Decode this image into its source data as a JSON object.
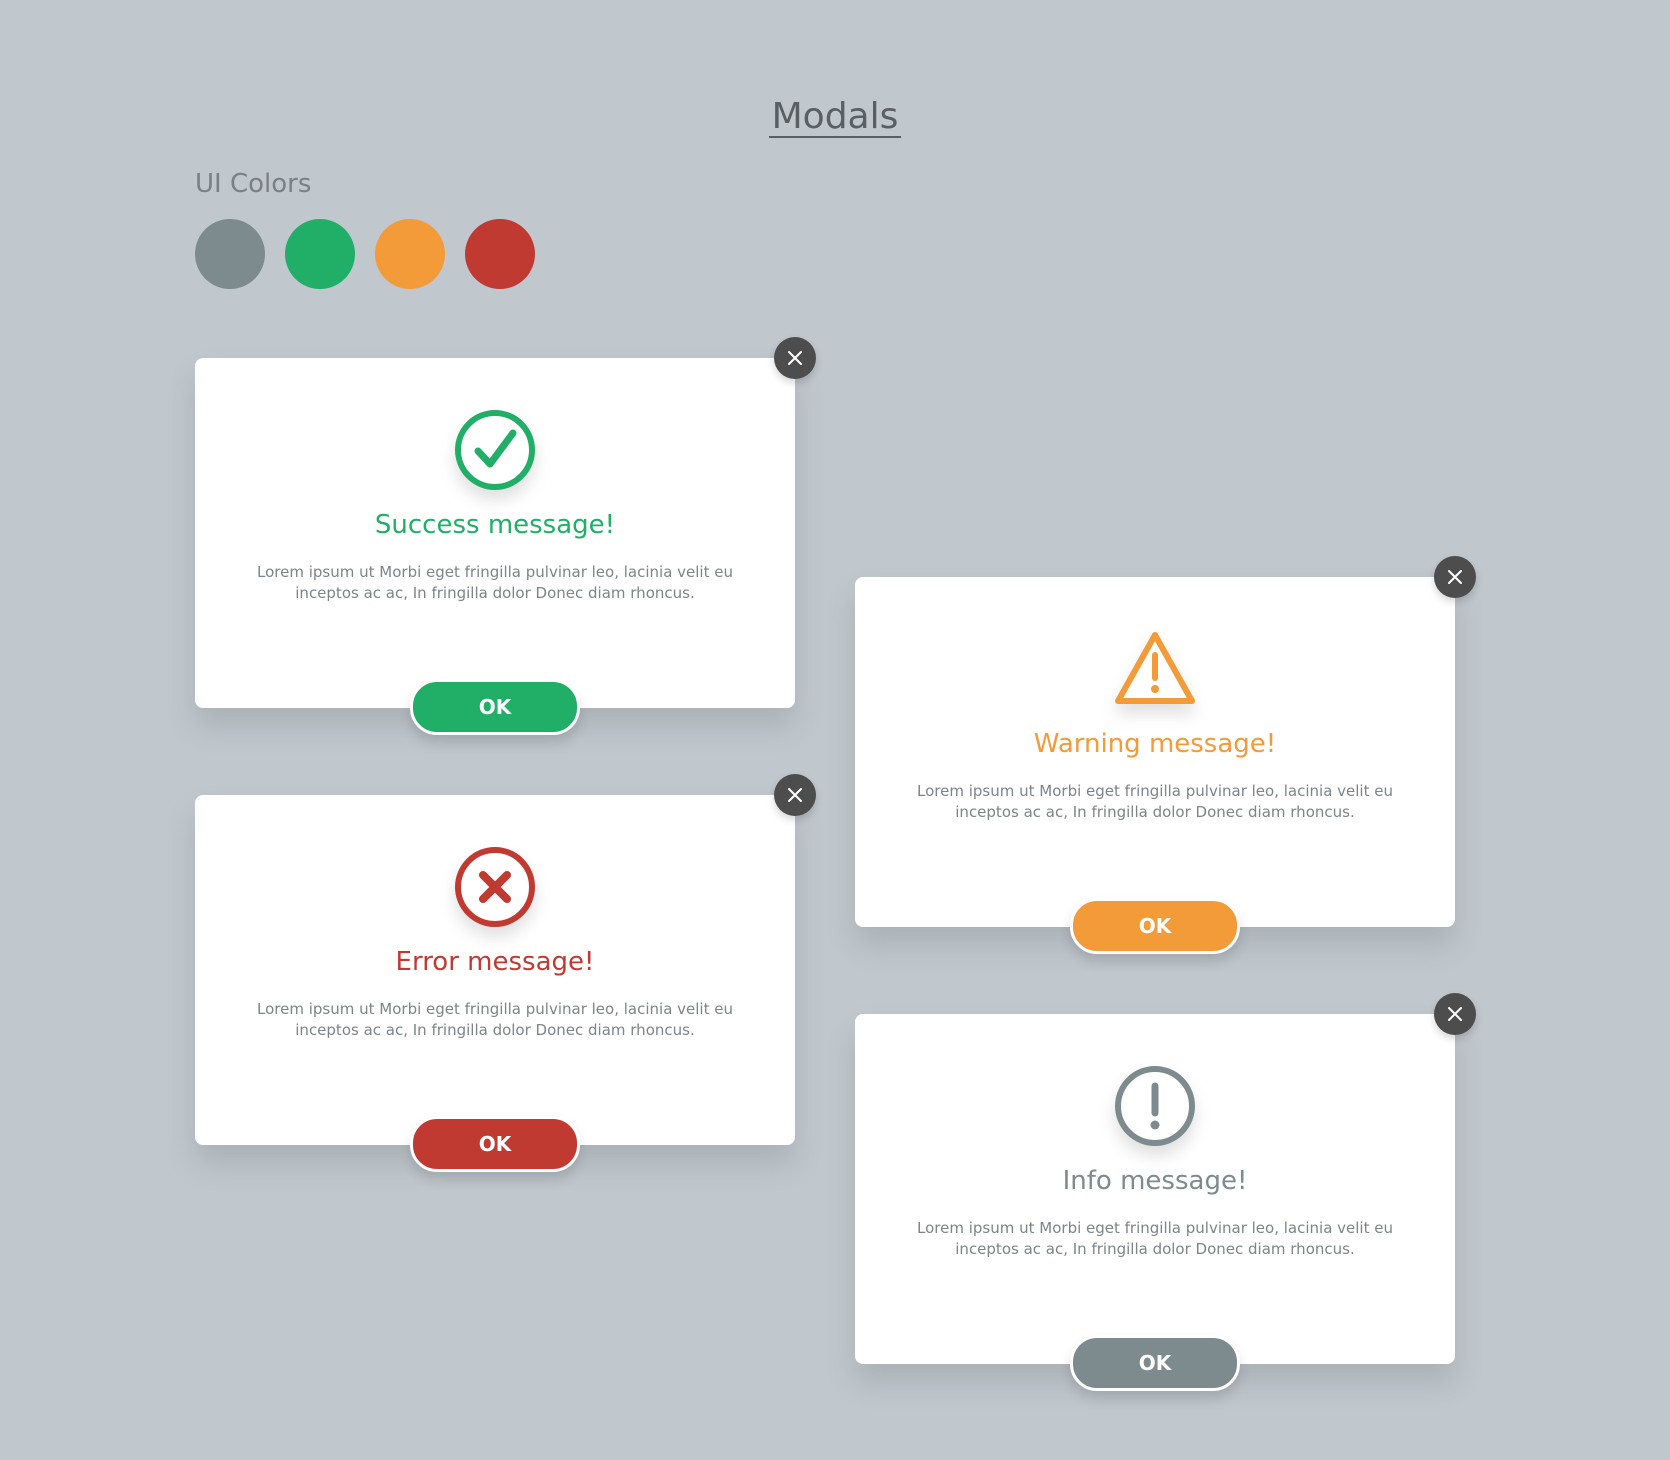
{
  "page": {
    "title": "Modals",
    "section_title": "UI Colors"
  },
  "colors": [
    {
      "name": "gray",
      "hex": "#7e8b8e"
    },
    {
      "name": "green",
      "hex": "#21ae66"
    },
    {
      "name": "orange",
      "hex": "#f39a39"
    },
    {
      "name": "red",
      "hex": "#c13a32"
    }
  ],
  "modals": [
    {
      "id": "success",
      "title": "Success message!",
      "body": "Lorem ipsum ut Morbi eget fringilla pulvinar leo, lacinia velit eu inceptos ac ac, In fringilla dolor Donec diam rhoncus.",
      "button_label": "OK",
      "icon": "check-circle-icon",
      "color": "#21ae66"
    },
    {
      "id": "warning",
      "title": "Warning message!",
      "body": "Lorem ipsum ut Morbi eget fringilla pulvinar leo, lacinia velit eu inceptos ac ac, In fringilla dolor Donec diam rhoncus.",
      "button_label": "OK",
      "icon": "warning-triangle-icon",
      "color": "#f39a39"
    },
    {
      "id": "error",
      "title": "Error message!",
      "body": "Lorem ipsum ut Morbi eget fringilla pulvinar leo, lacinia velit eu inceptos ac ac, In fringilla dolor Donec diam rhoncus.",
      "button_label": "OK",
      "icon": "error-x-circle-icon",
      "color": "#c13a32"
    },
    {
      "id": "info",
      "title": "Info message!",
      "body": "Lorem ipsum ut Morbi eget fringilla pulvinar leo, lacinia velit eu inceptos ac ac, In fringilla dolor Donec diam rhoncus.",
      "button_label": "OK",
      "icon": "info-exclamation-circle-icon",
      "color": "#7e8b8e"
    }
  ]
}
